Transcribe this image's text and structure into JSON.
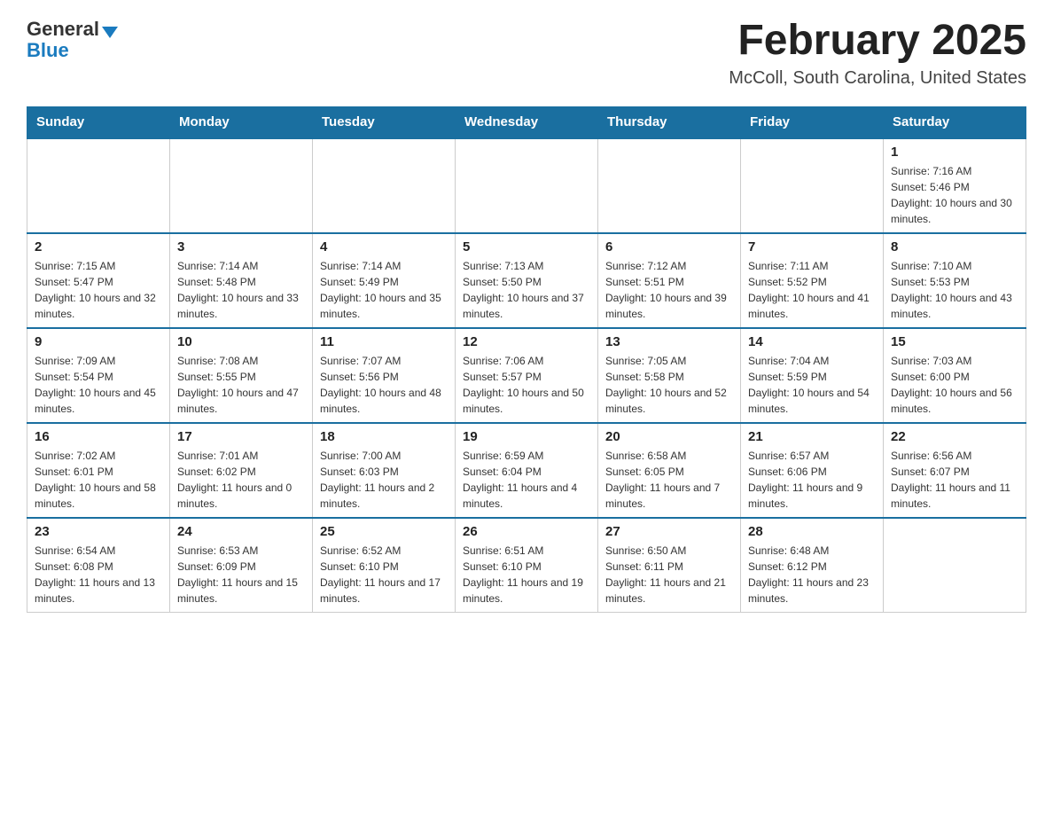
{
  "header": {
    "logo_general": "General",
    "logo_blue": "Blue",
    "month_title": "February 2025",
    "location": "McColl, South Carolina, United States"
  },
  "days_of_week": [
    "Sunday",
    "Monday",
    "Tuesday",
    "Wednesday",
    "Thursday",
    "Friday",
    "Saturday"
  ],
  "weeks": [
    [
      {
        "day": "",
        "sunrise": "",
        "sunset": "",
        "daylight": ""
      },
      {
        "day": "",
        "sunrise": "",
        "sunset": "",
        "daylight": ""
      },
      {
        "day": "",
        "sunrise": "",
        "sunset": "",
        "daylight": ""
      },
      {
        "day": "",
        "sunrise": "",
        "sunset": "",
        "daylight": ""
      },
      {
        "day": "",
        "sunrise": "",
        "sunset": "",
        "daylight": ""
      },
      {
        "day": "",
        "sunrise": "",
        "sunset": "",
        "daylight": ""
      },
      {
        "day": "1",
        "sunrise": "Sunrise: 7:16 AM",
        "sunset": "Sunset: 5:46 PM",
        "daylight": "Daylight: 10 hours and 30 minutes."
      }
    ],
    [
      {
        "day": "2",
        "sunrise": "Sunrise: 7:15 AM",
        "sunset": "Sunset: 5:47 PM",
        "daylight": "Daylight: 10 hours and 32 minutes."
      },
      {
        "day": "3",
        "sunrise": "Sunrise: 7:14 AM",
        "sunset": "Sunset: 5:48 PM",
        "daylight": "Daylight: 10 hours and 33 minutes."
      },
      {
        "day": "4",
        "sunrise": "Sunrise: 7:14 AM",
        "sunset": "Sunset: 5:49 PM",
        "daylight": "Daylight: 10 hours and 35 minutes."
      },
      {
        "day": "5",
        "sunrise": "Sunrise: 7:13 AM",
        "sunset": "Sunset: 5:50 PM",
        "daylight": "Daylight: 10 hours and 37 minutes."
      },
      {
        "day": "6",
        "sunrise": "Sunrise: 7:12 AM",
        "sunset": "Sunset: 5:51 PM",
        "daylight": "Daylight: 10 hours and 39 minutes."
      },
      {
        "day": "7",
        "sunrise": "Sunrise: 7:11 AM",
        "sunset": "Sunset: 5:52 PM",
        "daylight": "Daylight: 10 hours and 41 minutes."
      },
      {
        "day": "8",
        "sunrise": "Sunrise: 7:10 AM",
        "sunset": "Sunset: 5:53 PM",
        "daylight": "Daylight: 10 hours and 43 minutes."
      }
    ],
    [
      {
        "day": "9",
        "sunrise": "Sunrise: 7:09 AM",
        "sunset": "Sunset: 5:54 PM",
        "daylight": "Daylight: 10 hours and 45 minutes."
      },
      {
        "day": "10",
        "sunrise": "Sunrise: 7:08 AM",
        "sunset": "Sunset: 5:55 PM",
        "daylight": "Daylight: 10 hours and 47 minutes."
      },
      {
        "day": "11",
        "sunrise": "Sunrise: 7:07 AM",
        "sunset": "Sunset: 5:56 PM",
        "daylight": "Daylight: 10 hours and 48 minutes."
      },
      {
        "day": "12",
        "sunrise": "Sunrise: 7:06 AM",
        "sunset": "Sunset: 5:57 PM",
        "daylight": "Daylight: 10 hours and 50 minutes."
      },
      {
        "day": "13",
        "sunrise": "Sunrise: 7:05 AM",
        "sunset": "Sunset: 5:58 PM",
        "daylight": "Daylight: 10 hours and 52 minutes."
      },
      {
        "day": "14",
        "sunrise": "Sunrise: 7:04 AM",
        "sunset": "Sunset: 5:59 PM",
        "daylight": "Daylight: 10 hours and 54 minutes."
      },
      {
        "day": "15",
        "sunrise": "Sunrise: 7:03 AM",
        "sunset": "Sunset: 6:00 PM",
        "daylight": "Daylight: 10 hours and 56 minutes."
      }
    ],
    [
      {
        "day": "16",
        "sunrise": "Sunrise: 7:02 AM",
        "sunset": "Sunset: 6:01 PM",
        "daylight": "Daylight: 10 hours and 58 minutes."
      },
      {
        "day": "17",
        "sunrise": "Sunrise: 7:01 AM",
        "sunset": "Sunset: 6:02 PM",
        "daylight": "Daylight: 11 hours and 0 minutes."
      },
      {
        "day": "18",
        "sunrise": "Sunrise: 7:00 AM",
        "sunset": "Sunset: 6:03 PM",
        "daylight": "Daylight: 11 hours and 2 minutes."
      },
      {
        "day": "19",
        "sunrise": "Sunrise: 6:59 AM",
        "sunset": "Sunset: 6:04 PM",
        "daylight": "Daylight: 11 hours and 4 minutes."
      },
      {
        "day": "20",
        "sunrise": "Sunrise: 6:58 AM",
        "sunset": "Sunset: 6:05 PM",
        "daylight": "Daylight: 11 hours and 7 minutes."
      },
      {
        "day": "21",
        "sunrise": "Sunrise: 6:57 AM",
        "sunset": "Sunset: 6:06 PM",
        "daylight": "Daylight: 11 hours and 9 minutes."
      },
      {
        "day": "22",
        "sunrise": "Sunrise: 6:56 AM",
        "sunset": "Sunset: 6:07 PM",
        "daylight": "Daylight: 11 hours and 11 minutes."
      }
    ],
    [
      {
        "day": "23",
        "sunrise": "Sunrise: 6:54 AM",
        "sunset": "Sunset: 6:08 PM",
        "daylight": "Daylight: 11 hours and 13 minutes."
      },
      {
        "day": "24",
        "sunrise": "Sunrise: 6:53 AM",
        "sunset": "Sunset: 6:09 PM",
        "daylight": "Daylight: 11 hours and 15 minutes."
      },
      {
        "day": "25",
        "sunrise": "Sunrise: 6:52 AM",
        "sunset": "Sunset: 6:10 PM",
        "daylight": "Daylight: 11 hours and 17 minutes."
      },
      {
        "day": "26",
        "sunrise": "Sunrise: 6:51 AM",
        "sunset": "Sunset: 6:10 PM",
        "daylight": "Daylight: 11 hours and 19 minutes."
      },
      {
        "day": "27",
        "sunrise": "Sunrise: 6:50 AM",
        "sunset": "Sunset: 6:11 PM",
        "daylight": "Daylight: 11 hours and 21 minutes."
      },
      {
        "day": "28",
        "sunrise": "Sunrise: 6:48 AM",
        "sunset": "Sunset: 6:12 PM",
        "daylight": "Daylight: 11 hours and 23 minutes."
      },
      {
        "day": "",
        "sunrise": "",
        "sunset": "",
        "daylight": ""
      }
    ]
  ]
}
